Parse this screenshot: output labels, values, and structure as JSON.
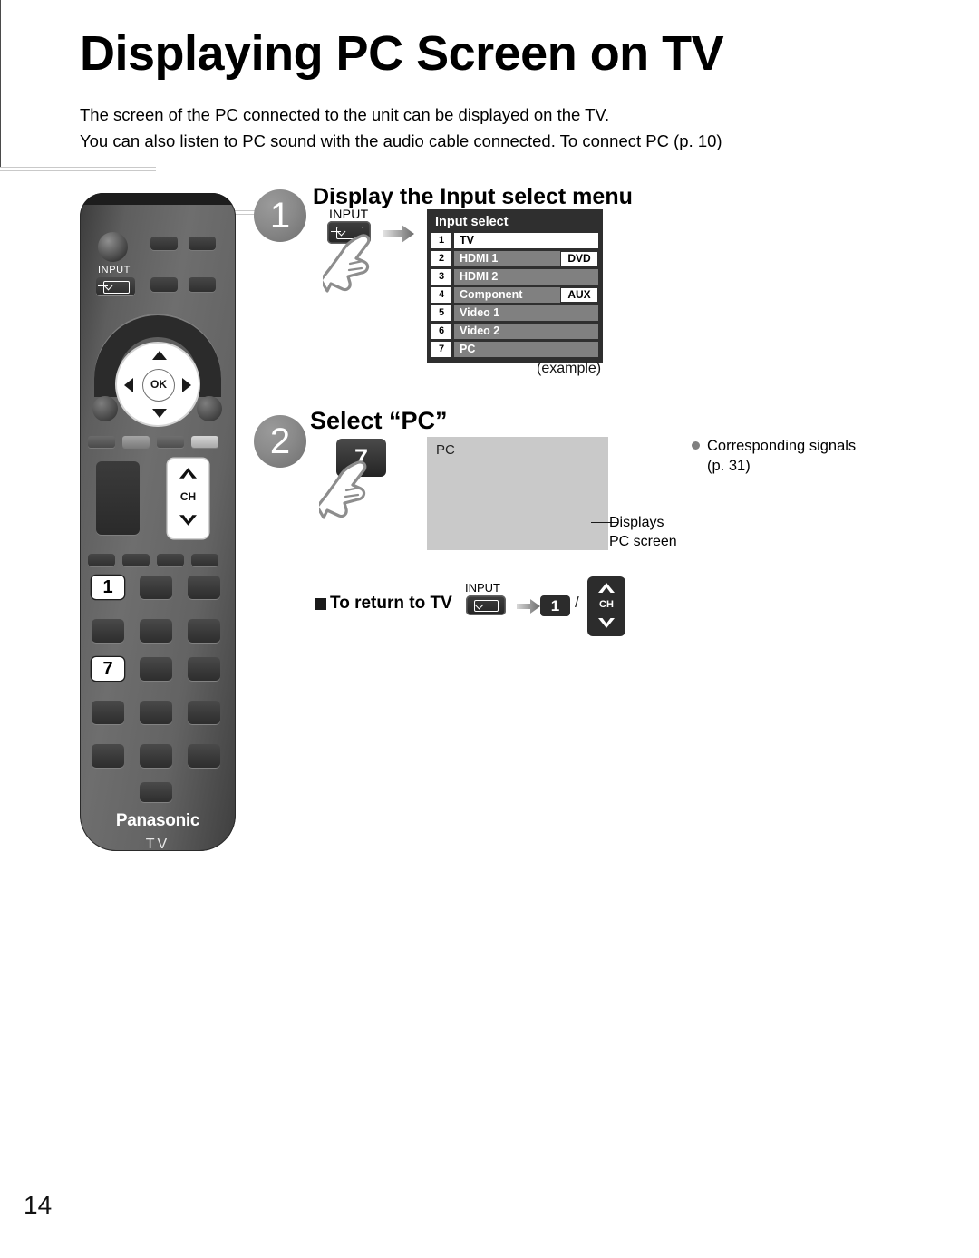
{
  "page": {
    "title": "Displaying PC Screen on TV",
    "intro_line1": "The screen of the PC connected to the unit can be displayed on the TV.",
    "intro_line2": "You can also listen to PC sound with the audio cable connected. To connect PC (p. 10)",
    "page_number": "14"
  },
  "steps": [
    {
      "number": "1",
      "heading": "Display the Input select menu"
    },
    {
      "number": "2",
      "heading": "Select “PC”"
    }
  ],
  "step1": {
    "input_key_label": "INPUT",
    "example_caption": "(example)",
    "arrow_icon": "right-arrow-icon",
    "hand_icon": "pointing-hand-icon",
    "input_icon": "input-source-icon"
  },
  "input_menu": {
    "title": "Input select",
    "rows": [
      {
        "num": "1",
        "label": "TV",
        "badge": "",
        "selected": true
      },
      {
        "num": "2",
        "label": "HDMI 1",
        "badge": "DVD",
        "selected": false
      },
      {
        "num": "3",
        "label": "HDMI 2",
        "badge": "",
        "selected": false
      },
      {
        "num": "4",
        "label": "Component",
        "badge": "AUX",
        "selected": false
      },
      {
        "num": "5",
        "label": "Video 1",
        "badge": "",
        "selected": false
      },
      {
        "num": "6",
        "label": "Video 2",
        "badge": "",
        "selected": false
      },
      {
        "num": "7",
        "label": "PC",
        "badge": "",
        "selected": false
      }
    ]
  },
  "step2": {
    "key_label": "7",
    "screen_label": "PC",
    "screen_caption_line1": "Displays",
    "screen_caption_line2": "PC screen",
    "note_line1": "Corresponding signals",
    "note_line2": "(p. 31)",
    "hand_icon": "pointing-hand-icon",
    "bullet_icon": "bullet-dot-icon"
  },
  "return_to_tv": {
    "label": "To return to TV",
    "input_key_label": "INPUT",
    "arrow_icon": "right-arrow-icon",
    "key_one": "1",
    "separator": "/",
    "ch_label": "CH",
    "ch_up_icon": "chevron-up-icon",
    "ch_down_icon": "chevron-down-icon",
    "square_icon": "filled-square-bullet-icon"
  },
  "remote": {
    "input_label": "INPUT",
    "ok_label": "OK",
    "ch_label": "CH",
    "highlight_key_1": "1",
    "highlight_key_7": "7",
    "brand": "Panasonic",
    "brand_sub": "TV",
    "power_icon": "power-button-icon",
    "dpad_up_icon": "arrow-up-icon",
    "dpad_down_icon": "arrow-down-icon",
    "dpad_left_icon": "arrow-left-icon",
    "dpad_right_icon": "arrow-right-icon",
    "ch_up_icon": "chevron-up-icon",
    "ch_down_icon": "chevron-down-icon"
  },
  "colors": {
    "badge_gray": "#808080",
    "menu_bg": "#2f2f2f",
    "menu_row_gray": "#808080",
    "pc_screen_gray": "#c9c9c9",
    "key_dark": "#2c2c2c"
  }
}
